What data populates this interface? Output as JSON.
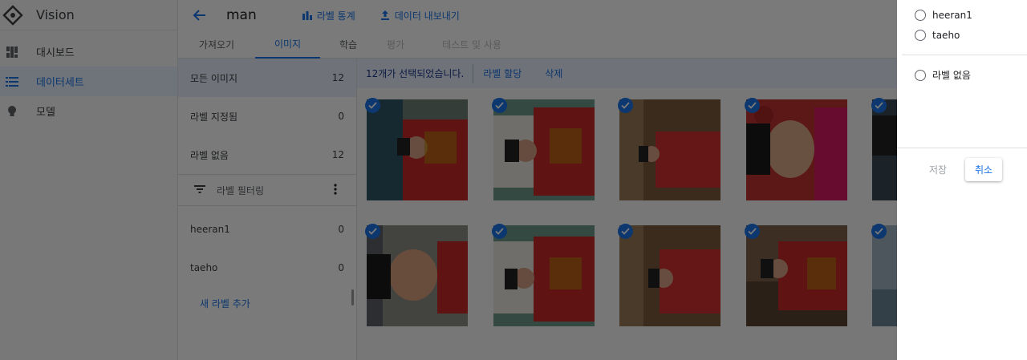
{
  "app": {
    "name": "Vision"
  },
  "nav": {
    "items": [
      {
        "label": "대시보드",
        "icon": "dashboard-icon",
        "active": false
      },
      {
        "label": "데이터세트",
        "icon": "list-icon",
        "active": true
      },
      {
        "label": "모델",
        "icon": "lightbulb-icon",
        "active": false
      }
    ]
  },
  "header": {
    "dataset_name": "man",
    "label_stats": "라벨 통계",
    "export": "데이터 내보내기"
  },
  "tabs": [
    {
      "label": "가져오기",
      "state": "normal"
    },
    {
      "label": "이미지",
      "state": "active"
    },
    {
      "label": "학습",
      "state": "normal"
    },
    {
      "label": "평가",
      "state": "disabled"
    },
    {
      "label": "테스트 및 사용",
      "state": "disabled"
    }
  ],
  "filters": {
    "all_images": {
      "label": "모든 이미지",
      "count": "12"
    },
    "labeled": {
      "label": "라벨 지정됨",
      "count": "0"
    },
    "unlabeled": {
      "label": "라벨 없음",
      "count": "12"
    },
    "filter_label": "라벨 필터링",
    "labels": [
      {
        "label": "heeran1",
        "count": "0"
      },
      {
        "label": "taeho",
        "count": "0"
      }
    ],
    "add_label": "새 라벨 추가"
  },
  "selection": {
    "count_text": "12개가 선택되었습니다.",
    "assign_label": "라벨 할당",
    "delete": "삭제"
  },
  "panel": {
    "options": [
      "heeran1",
      "taeho"
    ],
    "no_label_option": "라벨 없음",
    "save": "저장",
    "cancel": "취소"
  },
  "colors": {
    "accent": "#1a73e8",
    "selection_bg": "#e8eefc"
  }
}
